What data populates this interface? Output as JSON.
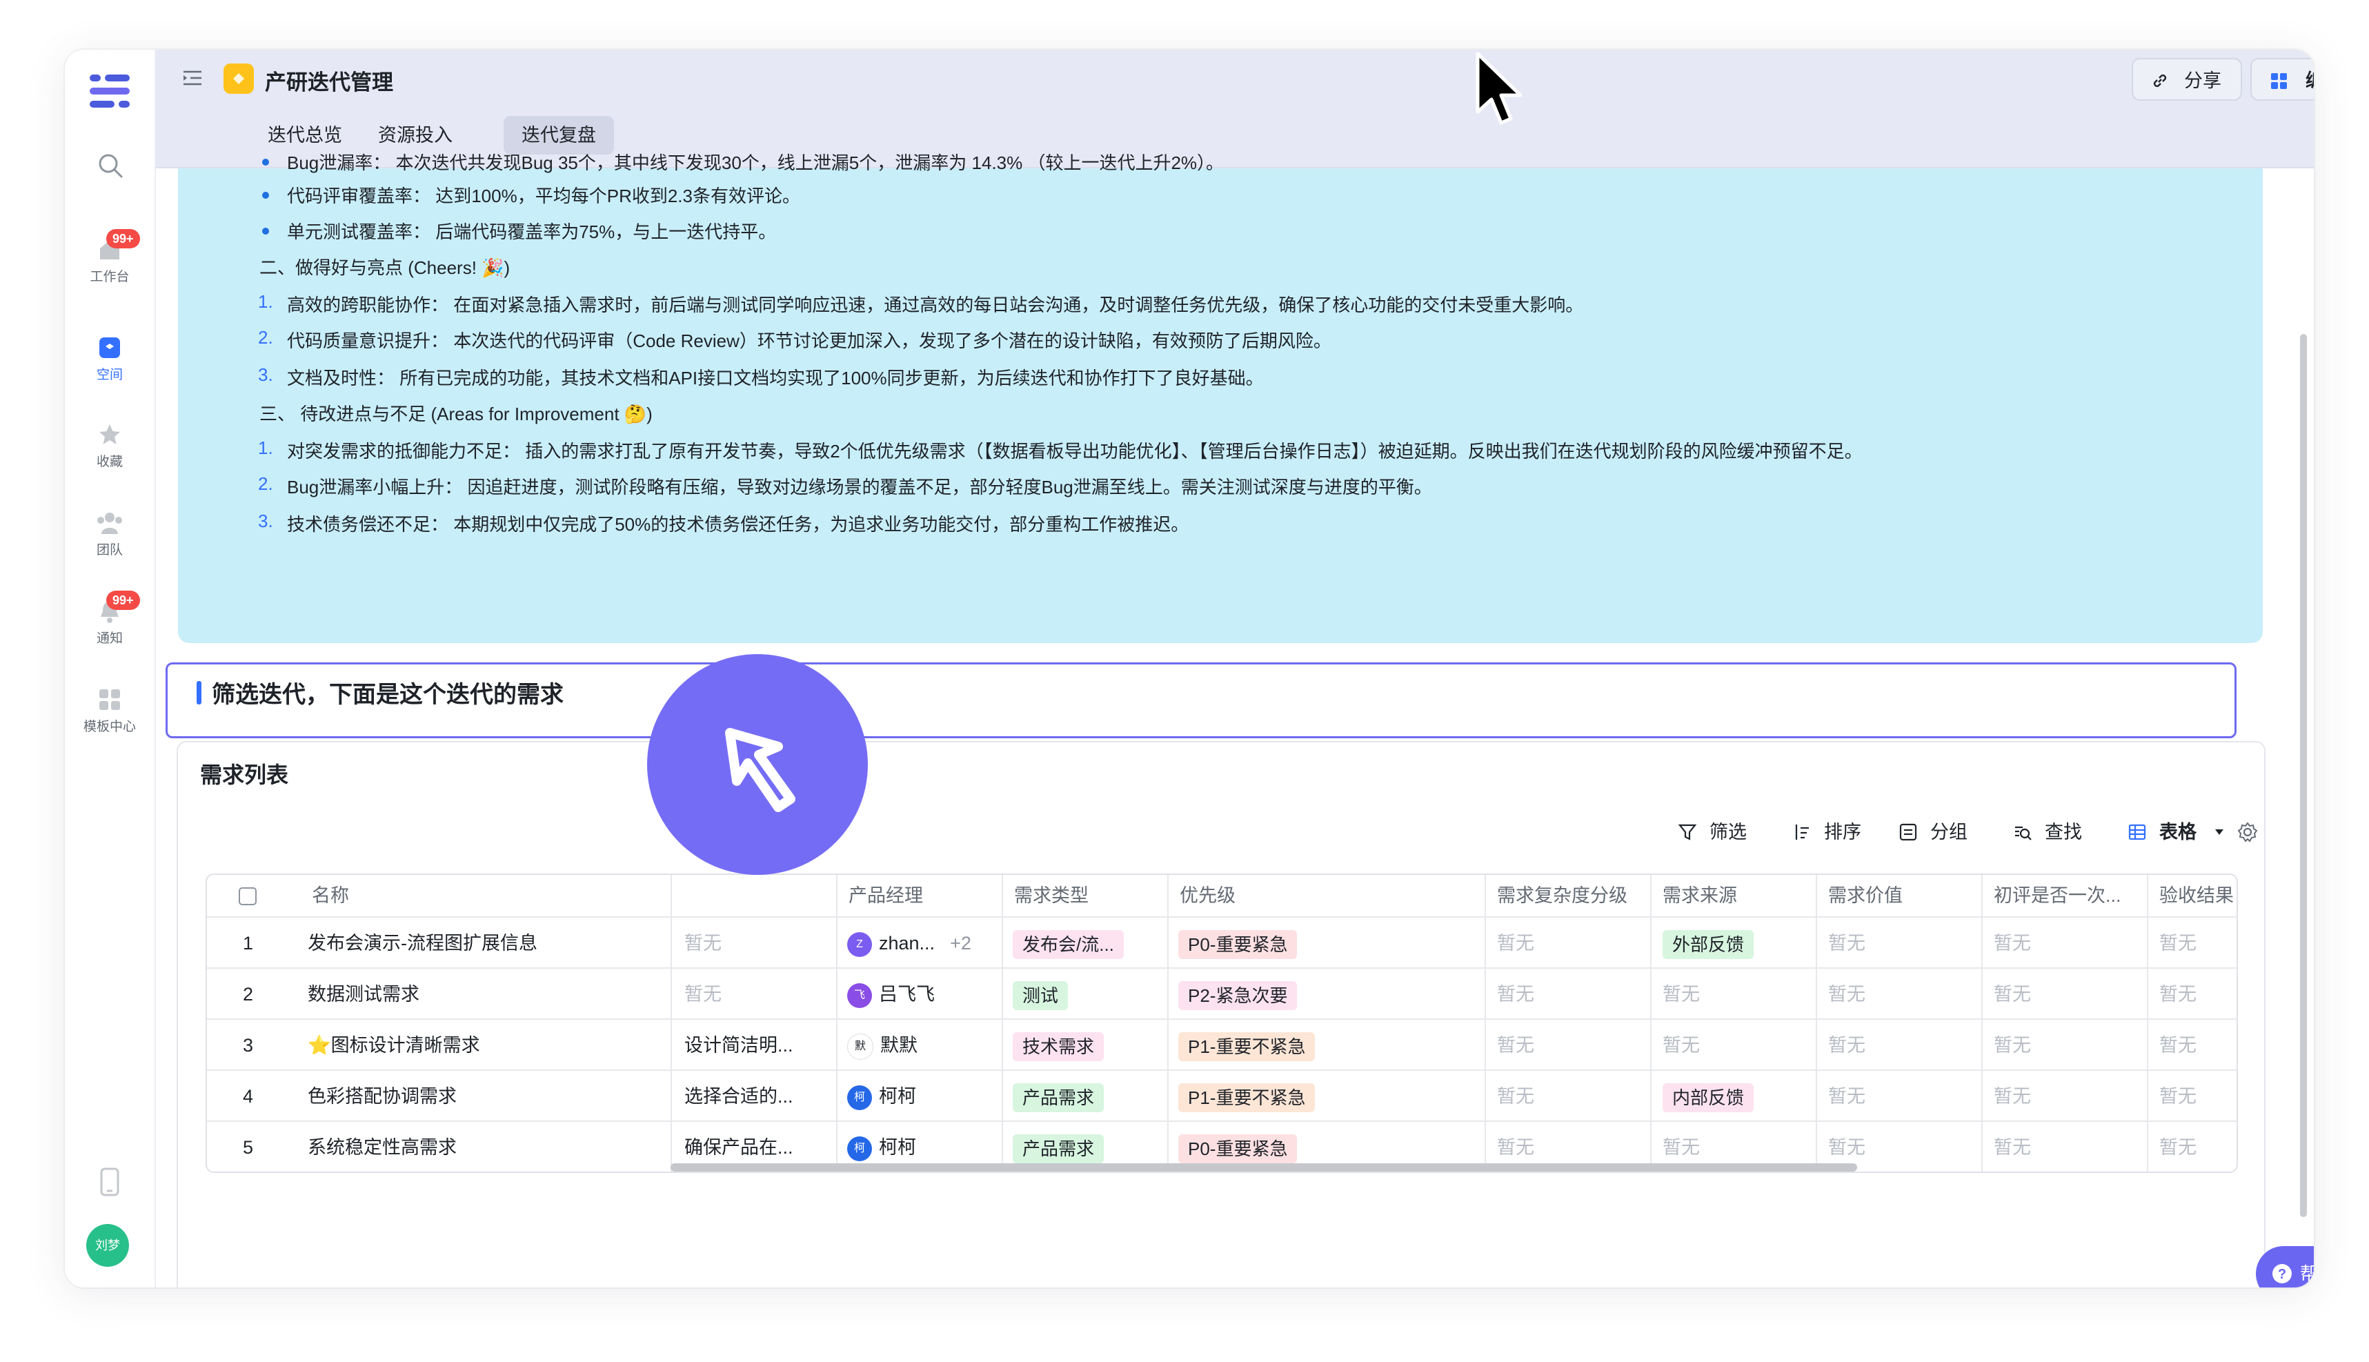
{
  "sidebar": {
    "items": [
      {
        "label": "工作台",
        "badge": "99+",
        "icon": "home-icon"
      },
      {
        "label": "空间",
        "icon": "space-icon"
      },
      {
        "label": "收藏",
        "icon": "star-icon"
      },
      {
        "label": "团队",
        "icon": "team-icon"
      },
      {
        "label": "通知",
        "badge": "99+",
        "icon": "bell-icon"
      },
      {
        "label": "模板中心",
        "icon": "template-icon"
      }
    ],
    "avatar_text": "刘梦"
  },
  "header": {
    "title": "产研迭代管理",
    "tabs": [
      "迭代总览",
      "资源投入",
      "迭代复盘"
    ],
    "share_label": "分享",
    "edit_label": "编辑"
  },
  "callout": {
    "lines": [
      "Bug泄漏率： 本次迭代共发现Bug 35个，其中线下发现30个，线上泄漏5个，泄漏率为 14.3% （较上一迭代上升2%）。",
      "代码评审覆盖率： 达到100%，平均每个PR收到2.3条有效评论。",
      "单元测试覆盖率： 后端代码覆盖率为75%，与上一迭代持平。",
      "二、做得好与亮点 (Cheers! 🎉)",
      "高效的跨职能协作： 在面对紧急插入需求时，前后端与测试同学响应迅速，通过高效的每日站会沟通，及时调整任务优先级，确保了核心功能的交付未受重大影响。",
      "代码质量意识提升： 本次迭代的代码评审（Code Review）环节讨论更加深入，发现了多个潜在的设计缺陷，有效预防了后期风险。",
      "文档及时性： 所有已完成的功能，其技术文档和API接口文档均实现了100%同步更新，为后续迭代和协作打下了良好基础。",
      "三、 待改进点与不足 (Areas for Improvement 🤔)",
      "对突发需求的抵御能力不足： 插入的需求打乱了原有开发节奏，导致2个低优先级需求（【数据看板导出功能优化】、【管理后台操作日志】）被迫延期。反映出我们在迭代规划阶段的风险缓冲预留不足。",
      "Bug泄漏率小幅上升： 因追赶进度，测试阶段略有压缩，导致对边缘场景的覆盖不足，部分轻度Bug泄漏至线上。需关注测试深度与进度的平衡。",
      "技术债务偿还不足： 本期规划中仅完成了50%的技术债务偿还任务，为追求业务功能交付，部分重构工作被推迟。"
    ],
    "numbers": [
      "1.",
      "2.",
      "3.",
      "1.",
      "2.",
      "3."
    ]
  },
  "section_title": "筛选迭代，下面是这个迭代的需求",
  "requirements": {
    "title": "需求列表",
    "toolbar": {
      "filter": "筛选",
      "sort": "排序",
      "group": "分组",
      "find": "查找",
      "view": "表格"
    },
    "columns": [
      "名称",
      "产品经理",
      "需求类型",
      "优先级",
      "需求复杂度分级",
      "需求来源",
      "需求价值",
      "初评是否一次...",
      "验收结果"
    ],
    "rows": [
      {
        "idx": "1",
        "name": "发布会演示-流程图扩展信息",
        "desc": "暂无",
        "pm": "zhan...",
        "pm_extra": "+2",
        "pm_avatar": "Z",
        "type": "发布会/流...",
        "priority": "P0-重要紧急",
        "complexity": "暂无",
        "source": "外部反馈",
        "value": "暂无",
        "first": "暂无",
        "accept": "暂无"
      },
      {
        "idx": "2",
        "name": "数据测试需求",
        "desc": "暂无",
        "pm": "吕飞飞",
        "pm_extra": "",
        "pm_avatar": "飞",
        "type": "测试",
        "priority": "P2-紧急次要",
        "complexity": "暂无",
        "source": "暂无",
        "value": "暂无",
        "first": "暂无",
        "accept": "暂无"
      },
      {
        "idx": "3",
        "name": "⭐图标设计清晰需求",
        "desc": "设计简洁明...",
        "pm": "默默",
        "pm_extra": "",
        "pm_avatar": "默",
        "type": "技术需求",
        "priority": "P1-重要不紧急",
        "complexity": "暂无",
        "source": "暂无",
        "value": "暂无",
        "first": "暂无",
        "accept": "暂无"
      },
      {
        "idx": "4",
        "name": "色彩搭配协调需求",
        "desc": "选择合适的...",
        "pm": "柯柯",
        "pm_extra": "",
        "pm_avatar": "柯",
        "type": "产品需求",
        "priority": "P1-重要不紧急",
        "complexity": "暂无",
        "source": "内部反馈",
        "value": "暂无",
        "first": "暂无",
        "accept": "暂无"
      },
      {
        "idx": "5",
        "name": "系统稳定性高需求",
        "desc": "确保产品在...",
        "pm": "柯柯",
        "pm_extra": "",
        "pm_avatar": "柯",
        "type": "产品需求",
        "priority": "P0-重要紧急",
        "complexity": "暂无",
        "source": "暂无",
        "value": "暂无",
        "first": "暂无",
        "accept": "暂无"
      }
    ]
  },
  "help_label": "帮助",
  "colors": {
    "accent": "#3370ff",
    "callout_bg": "#c8eef9",
    "fab": "#756cf5"
  }
}
